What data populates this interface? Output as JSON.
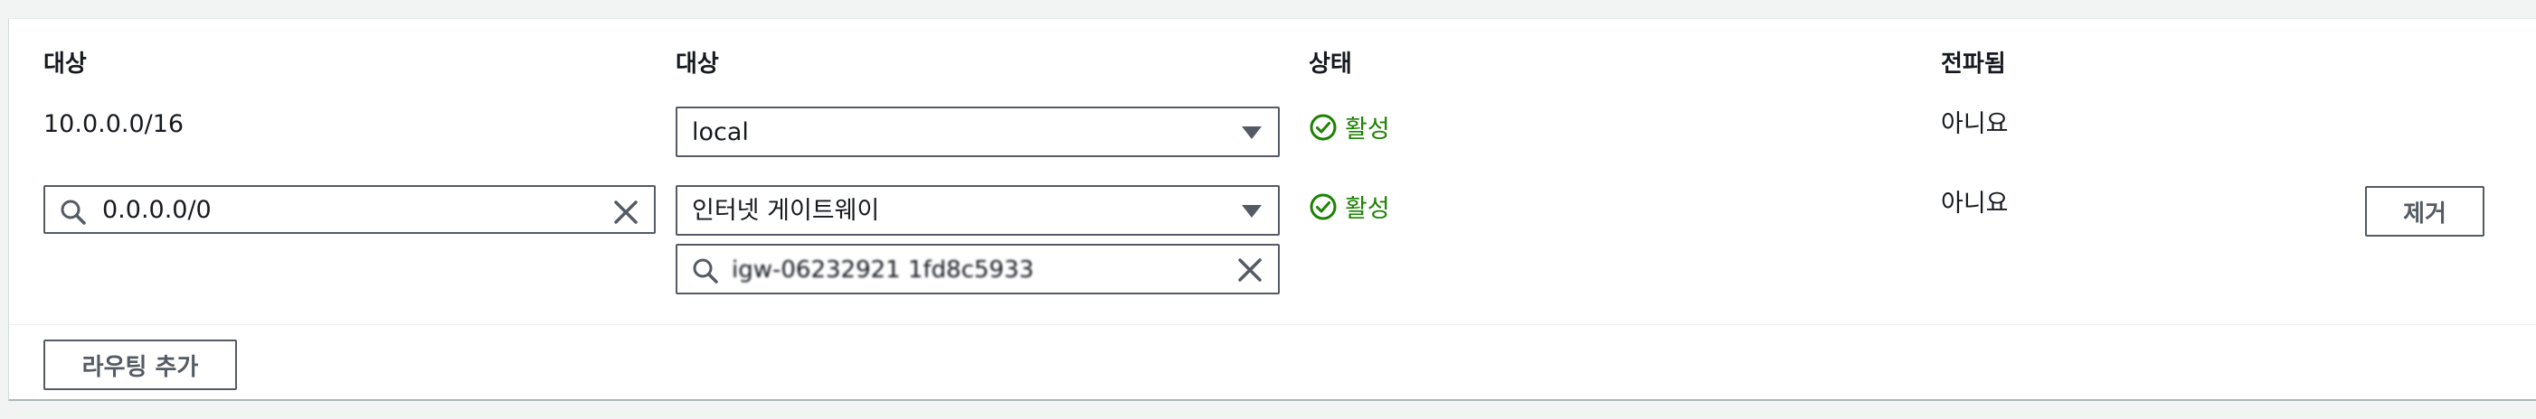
{
  "headers": {
    "destination": "대상",
    "target": "대상",
    "status": "상태",
    "propagated": "전파됨"
  },
  "rows": [
    {
      "destination": "10.0.0.0/16",
      "target_select": "local",
      "status": "활성",
      "propagated": "아니요"
    },
    {
      "destination_input": "0.0.0.0/0",
      "target_select": "인터넷 게이트웨이",
      "target_search": "igw-06232921 1fd8c5933",
      "status": "활성",
      "propagated": "아니요",
      "remove_label": "제거"
    }
  ],
  "add_route_label": "라우팅 추가",
  "colors": {
    "status_green": "#1d8102",
    "border": "#545b64"
  }
}
